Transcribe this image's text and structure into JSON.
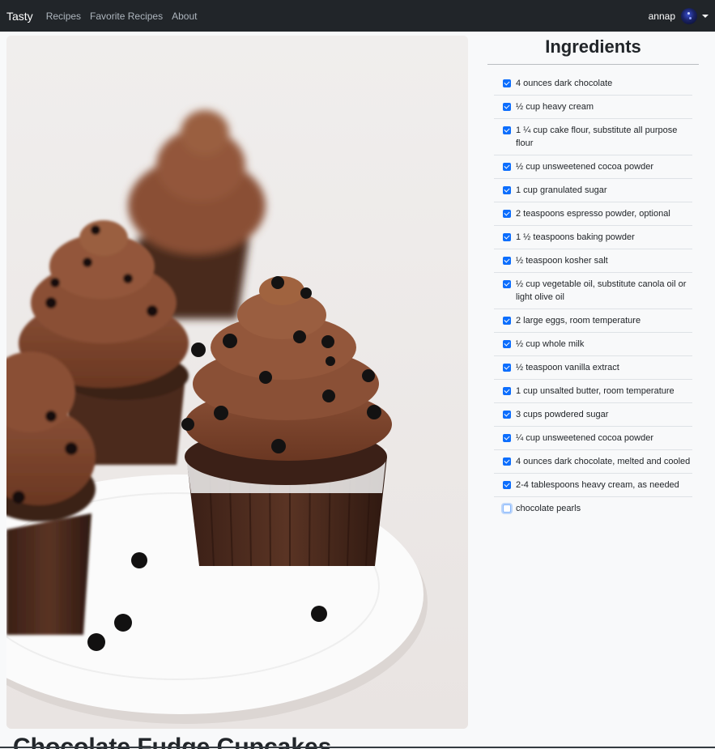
{
  "nav": {
    "brand": "Tasty",
    "links": [
      "Recipes",
      "Favorite Recipes",
      "About"
    ],
    "username": "annap"
  },
  "recipe": {
    "title": "Chocolate Fudge Cupcakes"
  },
  "ingredients": {
    "title": "Ingredients",
    "items": [
      {
        "text": "4 ounces dark chocolate",
        "checked": true
      },
      {
        "text": "½ cup heavy cream",
        "checked": true
      },
      {
        "text": "1 ¼ cup cake flour, substitute all purpose flour",
        "checked": true
      },
      {
        "text": "½ cup unsweetened cocoa powder",
        "checked": true
      },
      {
        "text": "1 cup granulated sugar",
        "checked": true
      },
      {
        "text": "2 teaspoons espresso powder, optional",
        "checked": true
      },
      {
        "text": "1 ½ teaspoons baking powder",
        "checked": true
      },
      {
        "text": "½ teaspoon kosher salt",
        "checked": true
      },
      {
        "text": "½ cup vegetable oil, substitute canola oil or light olive oil",
        "checked": true
      },
      {
        "text": "2 large eggs, room temperature",
        "checked": true
      },
      {
        "text": "½ cup whole milk",
        "checked": true
      },
      {
        "text": "½ teaspoon vanilla extract",
        "checked": true
      },
      {
        "text": "1 cup unsalted butter, room temperature",
        "checked": true
      },
      {
        "text": "3 cups powdered sugar",
        "checked": true
      },
      {
        "text": "¼ cup unsweetened cocoa powder",
        "checked": true
      },
      {
        "text": "4 ounces dark chocolate, melted and cooled",
        "checked": true
      },
      {
        "text": "2-4 tablespoons heavy cream, as needed",
        "checked": true
      },
      {
        "text": "chocolate pearls",
        "checked": false
      }
    ]
  },
  "colors": {
    "navbar": "#212529",
    "checkbox": "#0d6efd",
    "page": "#f8f9fa"
  }
}
